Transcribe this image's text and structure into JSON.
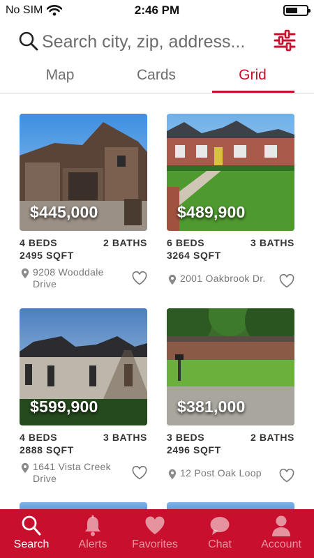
{
  "status_bar": {
    "carrier": "No SIM",
    "time": "2:46 PM"
  },
  "search": {
    "placeholder": "Search city, zip, address..."
  },
  "tabs": [
    {
      "label": "Map",
      "active": false
    },
    {
      "label": "Cards",
      "active": false
    },
    {
      "label": "Grid",
      "active": true
    }
  ],
  "listings": [
    {
      "price": "$445,000",
      "beds": "4 BEDS",
      "baths": "2 BATHS",
      "sqft": "2495 SQFT",
      "address": "9208 Wooddale Drive"
    },
    {
      "price": "$489,900",
      "beds": "6 BEDS",
      "baths": "3 BATHS",
      "sqft": "3264 SQFT",
      "address": "2001 Oakbrook Dr."
    },
    {
      "price": "$599,900",
      "beds": "4 BEDS",
      "baths": "3 BATHS",
      "sqft": "2888 SQFT",
      "address": "1641 Vista Creek Drive"
    },
    {
      "price": "$381,000",
      "beds": "3 BEDS",
      "baths": "2 BATHS",
      "sqft": "2496 SQFT",
      "address": "12 Post Oak Loop"
    }
  ],
  "bottom_nav": [
    {
      "label": "Search",
      "icon": "search-icon",
      "active": true
    },
    {
      "label": "Alerts",
      "icon": "bell-icon",
      "active": false
    },
    {
      "label": "Favorites",
      "icon": "heart-icon",
      "active": false
    },
    {
      "label": "Chat",
      "icon": "chat-bubble-icon",
      "active": false
    },
    {
      "label": "Account",
      "icon": "person-icon",
      "active": false
    }
  ],
  "colors": {
    "accent": "#c8102e",
    "tab_inactive": "#6d6d6d",
    "text_muted": "#777777"
  }
}
